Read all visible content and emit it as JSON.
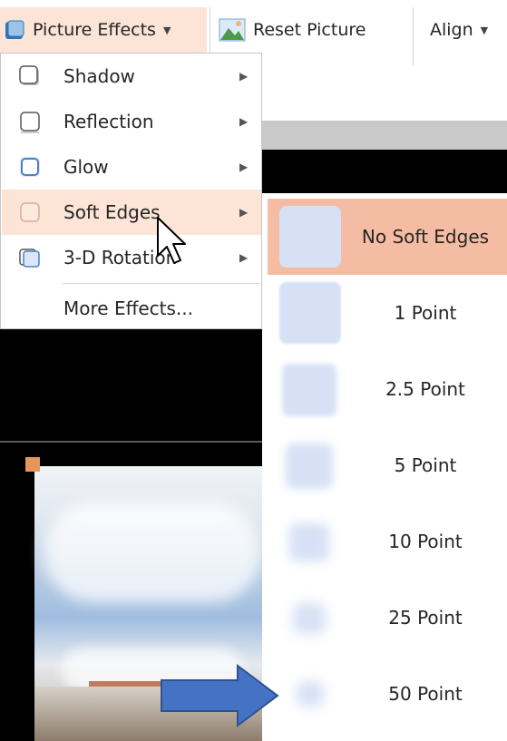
{
  "ribbon": {
    "picture_effects_label": "Picture Effects",
    "reset_picture_label": "Reset Picture",
    "align_label": "Align"
  },
  "menu": {
    "items": [
      {
        "label": "Shadow",
        "icon": "shadow-square-icon",
        "has_submenu": true
      },
      {
        "label": "Reflection",
        "icon": "reflection-square-icon",
        "has_submenu": true
      },
      {
        "label": "Glow",
        "icon": "glow-square-icon",
        "has_submenu": true
      },
      {
        "label": "Soft Edges",
        "icon": "soft-edges-square-icon",
        "has_submenu": true,
        "highlighted": true
      },
      {
        "label": "3-D Rotation",
        "icon": "rotation-3d-icon",
        "has_submenu": true
      },
      {
        "label": "More Effects...",
        "has_submenu": false
      }
    ]
  },
  "submenu": {
    "items": [
      {
        "label": "No Soft Edges",
        "selected": true
      },
      {
        "label": "1 Point"
      },
      {
        "label": "2.5 Point"
      },
      {
        "label": "5 Point"
      },
      {
        "label": "10 Point"
      },
      {
        "label": "25 Point"
      },
      {
        "label": "50 Point"
      }
    ]
  },
  "colors": {
    "menu_highlight": "#fce4d6",
    "submenu_selected": "#f4bca2",
    "icon_fill": "#d6e1f5",
    "arrow": "#4472c4"
  }
}
